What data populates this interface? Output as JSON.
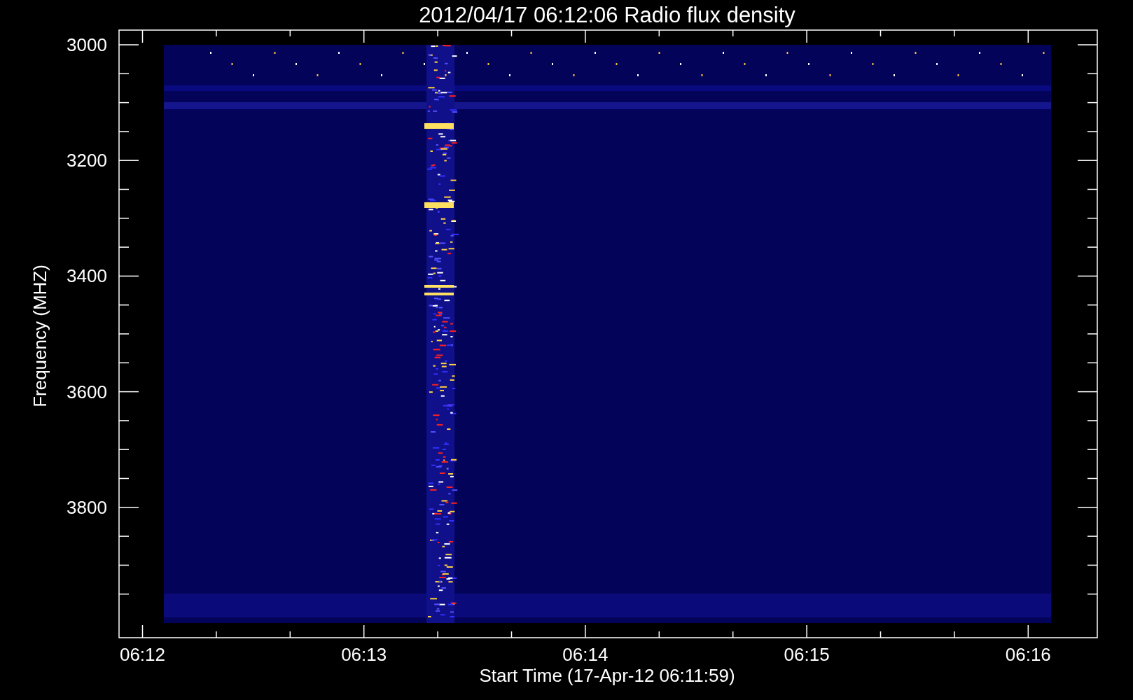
{
  "title": "2012/04/17 06:12:06 Radio flux density",
  "y_axis": {
    "label": "Frequency (MHZ)",
    "ticks": [
      "3000",
      "3200",
      "3400",
      "3600",
      "3800"
    ]
  },
  "x_axis": {
    "label": "Start Time (17-Apr-12 06:11:59)",
    "ticks": [
      "06:12",
      "06:13",
      "06:14",
      "06:15",
      "06:16"
    ]
  }
}
